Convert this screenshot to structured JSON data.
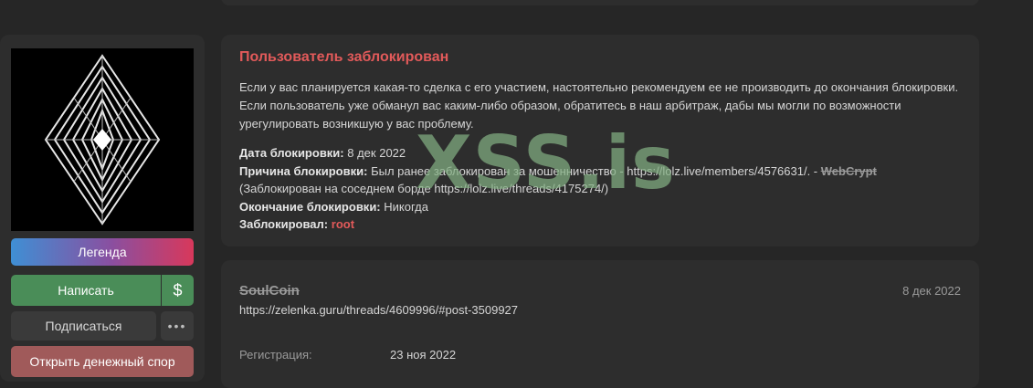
{
  "sidebar": {
    "legend_label": "Легенда",
    "write_label": "Написать",
    "dollar_label": "$",
    "subscribe_label": "Подписаться",
    "more_label": "•••",
    "dispute_label": "Открыть денежный спор"
  },
  "ban": {
    "title": "Пользователь заблокирован",
    "text": "Если у вас планируется какая-то сделка с его участием, настоятельно рекомендуем ее не производить до окончания блокировки. Если пользователь уже обманул вас каким-либо образом, обратитесь в наш арбитраж, дабы мы могли по возможности урегулировать возникшую у вас проблему.",
    "date_label": "Дата блокировки:",
    "date_value": " 8 дек 2022",
    "reason_label": "Причина блокировки:",
    "reason_value": " Был ранее заблокирован за мошенничество - https://lolz.live/members/4576631/. - ",
    "reason_strike": "WebCrypt",
    "reason_line2": "(Заблокирован на соседнем борде https://lolz.live/threads/4175274/)",
    "end_label": "Окончание блокировки:",
    "end_value": " Никогда",
    "by_label": "Заблокировал:",
    "by_value": "root"
  },
  "post": {
    "username": "SoulCoin",
    "date": "8 дек 2022",
    "link": "https://zelenka.guru/threads/4609996/#post-3509927",
    "reg_label": "Регистрация:",
    "reg_value": "23 ноя 2022"
  },
  "watermark": "XSS.is"
}
